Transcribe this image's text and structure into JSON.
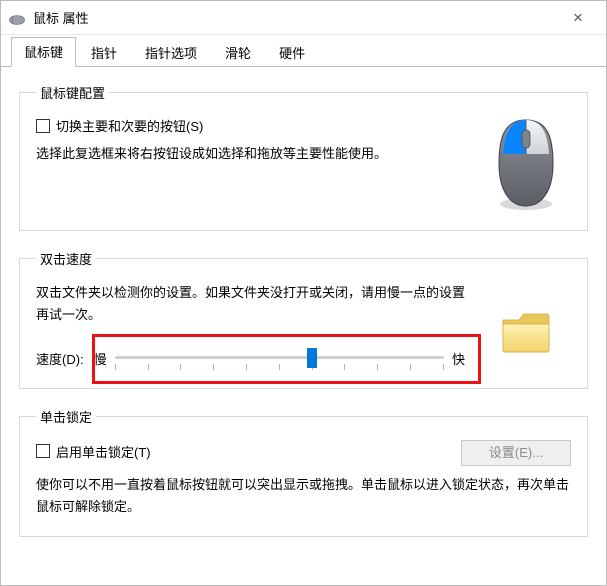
{
  "window": {
    "title": "鼠标 属性"
  },
  "tabs": {
    "t0": "鼠标键",
    "t1": "指针",
    "t2": "指针选项",
    "t3": "滑轮",
    "t4": "硬件",
    "active_index": 0
  },
  "group1": {
    "legend": "鼠标键配置",
    "checkbox_label": "切换主要和次要的按钮(S)",
    "checkbox_checked": false,
    "description": "选择此复选框来将右按钮设成如选择和拖放等主要性能使用。"
  },
  "group2": {
    "legend": "双击速度",
    "description": "双击文件夹以检测你的设置。如果文件夹没打开或关闭，请用慢一点的设置再试一次。",
    "speed_label": "速度(D):",
    "speed_min": "慢",
    "speed_max": "快",
    "speed_value": 60,
    "annotation_highlight": true
  },
  "group3": {
    "legend": "单击锁定",
    "checkbox_label": "启用单击锁定(T)",
    "checkbox_checked": false,
    "settings_button": "设置(E)...",
    "settings_button_enabled": false,
    "description": "使你可以不用一直按着鼠标按钮就可以突出显示或拖拽。单击鼠标以进入锁定状态，再次单击鼠标可解除锁定。"
  },
  "icons": {
    "app_icon": "mouse-icon",
    "close": "×",
    "mouse_image": "mouse-illustration",
    "folder_image": "folder-illustration"
  },
  "colors": {
    "accent": "#0078d7",
    "annotation": "#e11"
  }
}
